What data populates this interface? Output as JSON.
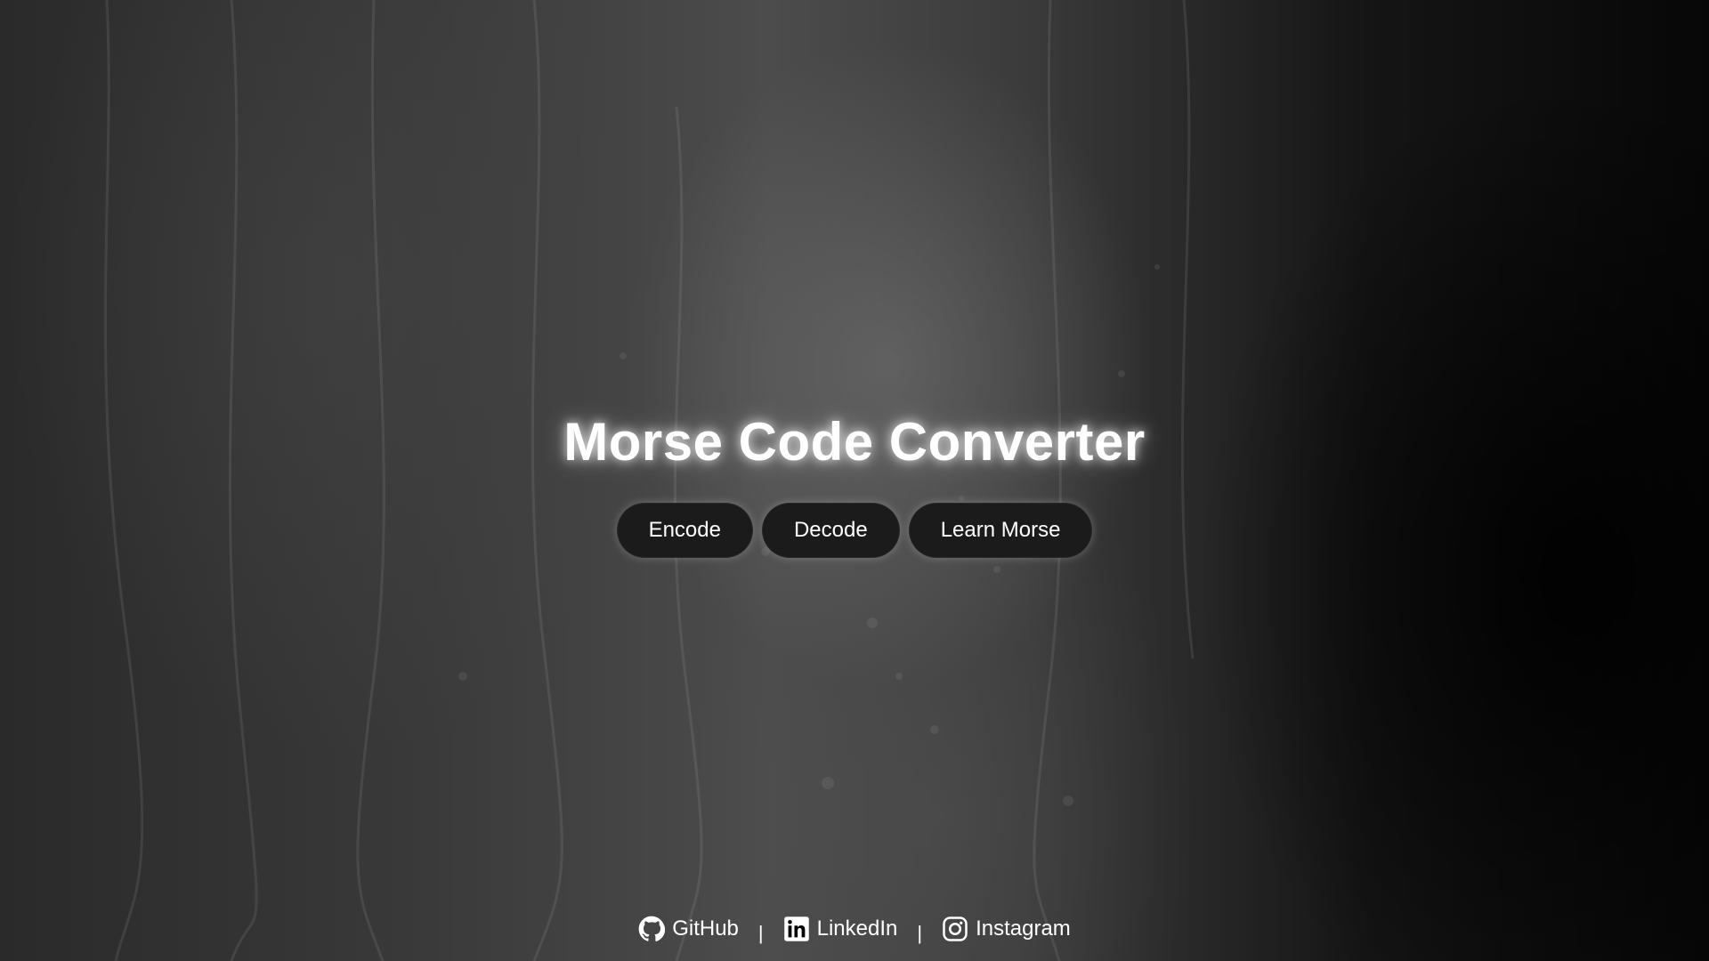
{
  "header": {
    "title": "Morse Code Converter"
  },
  "nav": {
    "buttons": [
      {
        "label": "Encode"
      },
      {
        "label": "Decode"
      },
      {
        "label": "Learn Morse"
      }
    ]
  },
  "footer": {
    "links": [
      {
        "label": "GitHub",
        "icon": "github-icon"
      },
      {
        "label": "LinkedIn",
        "icon": "linkedin-icon"
      },
      {
        "label": "Instagram",
        "icon": "instagram-icon"
      }
    ],
    "separator": "|"
  },
  "theme": {
    "button_bg": "#1b1b1b",
    "text": "#ffffff",
    "background": "dark rainy window"
  }
}
